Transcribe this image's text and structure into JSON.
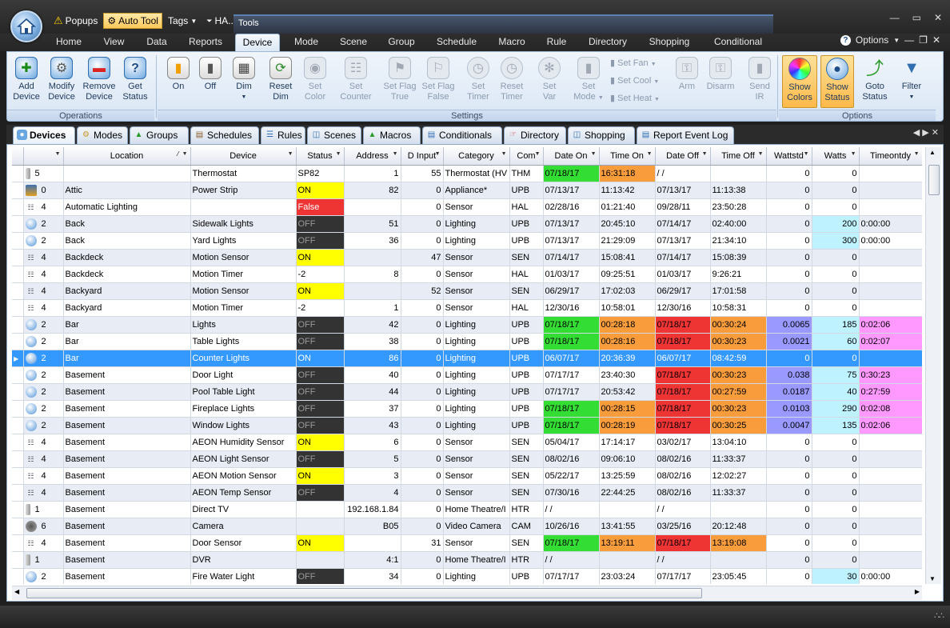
{
  "quick_access": {
    "popups": "Popups",
    "auto_tool": "Auto Tool",
    "tags": "Tags",
    "ha": "HA...",
    "tools": "Tools"
  },
  "ribbon_tabs": [
    "Home",
    "View",
    "Data",
    "Reports",
    "Device",
    "Mode",
    "Scene",
    "Group",
    "Schedule",
    "Macro",
    "Rule",
    "Directory",
    "Shopping",
    "Conditional"
  ],
  "options_label": "Options",
  "ribbon_groups": {
    "operations": "Operations",
    "settings": "Settings",
    "options": "Options"
  },
  "ribbon_buttons": {
    "add_device": [
      "Add",
      "Device"
    ],
    "modify_device": [
      "Modify",
      "Device"
    ],
    "remove_device": [
      "Remove",
      "Device"
    ],
    "get_status": [
      "Get",
      "Status"
    ],
    "on": "On",
    "off": "Off",
    "dim": "Dim",
    "reset_dim": [
      "Reset",
      "Dim"
    ],
    "set_color": [
      "Set",
      "Color"
    ],
    "set_counter": [
      "Set",
      "Counter"
    ],
    "set_flag_true": [
      "Set Flag",
      "True"
    ],
    "set_flag_false": [
      "Set Flag",
      "False"
    ],
    "set_timer": [
      "Set",
      "Timer"
    ],
    "reset_timer": [
      "Reset",
      "Timer"
    ],
    "set_var": [
      "Set",
      "Var"
    ],
    "set_mode": [
      "Set",
      "Mode"
    ],
    "set_fan": "Set Fan",
    "set_cool": "Set Cool",
    "set_heat": "Set Heat",
    "arm": "Arm",
    "disarm": "Disarm",
    "send_ir": [
      "Send",
      "IR"
    ],
    "show_colors": [
      "Show",
      "Colors"
    ],
    "show_status": [
      "Show",
      "Status"
    ],
    "goto_status": [
      "Goto",
      "Status"
    ],
    "filter": "Filter"
  },
  "doc_tabs": [
    "Devices",
    "Modes",
    "Groups",
    "Schedules",
    "Rules",
    "Scenes",
    "Macros",
    "Conditionals",
    "Directory",
    "Shopping",
    "Report Event Log"
  ],
  "columns": [
    "",
    "Location",
    "Device",
    "Status",
    "Address",
    "D Input",
    "Category",
    "Com",
    "Date On",
    "Time On",
    "Date Off",
    "Time Off",
    "Wattstd",
    "Watts",
    "Timeontdy"
  ],
  "colors": {
    "on_yellow": "#ffff00",
    "false_red": "#ef3434",
    "off_dark": "#333333",
    "green": "#33dd33",
    "orange": "#f99c3c",
    "red": "#ef3434",
    "purple": "#9999ff",
    "cyan": "#bff2ff",
    "pink": "#ff99ff",
    "selected": "#3399ff"
  },
  "rows": [
    {
      "icon": "thermostat-icon",
      "type": "5",
      "location": "",
      "device": "Thermostat",
      "status": "SP82",
      "address": "1",
      "dinput": "55",
      "category": "Thermostat (HV",
      "com": "THM",
      "date_on": "07/18/17",
      "time_on": "16:31:18",
      "date_off": " / /",
      "time_off": "",
      "wattstd": "0",
      "watts": "0",
      "timeontdy": "",
      "c_date_on": "green",
      "c_time_on": "orange"
    },
    {
      "icon": "power-strip-icon",
      "type": "0",
      "location": "Attic",
      "device": "Power Strip",
      "status": "ON",
      "address": "82",
      "dinput": "0",
      "category": "Appliance*",
      "com": "UPB",
      "date_on": "07/13/17",
      "time_on": "11:13:42",
      "date_off": "07/13/17",
      "time_off": "11:13:38",
      "wattstd": "0",
      "watts": "0",
      "timeontdy": "",
      "c_status": "on_yellow"
    },
    {
      "icon": "sensor-icon",
      "type": "4",
      "location": "Automatic Lighting",
      "device": "",
      "status": "False",
      "address": "",
      "dinput": "0",
      "category": "Sensor",
      "com": "HAL",
      "date_on": "02/28/16",
      "time_on": "01:21:40",
      "date_off": "09/28/11",
      "time_off": "23:50:28",
      "wattstd": "0",
      "watts": "0",
      "timeontdy": "",
      "c_status": "false_red"
    },
    {
      "icon": "bulb-icon",
      "type": "2",
      "location": "Back",
      "device": "Sidewalk Lights",
      "status": "OFF",
      "address": "51",
      "dinput": "0",
      "category": "Lighting",
      "com": "UPB",
      "date_on": "07/13/17",
      "time_on": "20:45:10",
      "date_off": "07/14/17",
      "time_off": "02:40:00",
      "wattstd": "0",
      "watts": "200",
      "timeontdy": "0:00:00",
      "c_status": "off_dark",
      "c_watts": "cyan"
    },
    {
      "icon": "bulb-icon",
      "type": "2",
      "location": "Back",
      "device": "Yard Lights",
      "status": "OFF",
      "address": "36",
      "dinput": "0",
      "category": "Lighting",
      "com": "UPB",
      "date_on": "07/13/17",
      "time_on": "21:29:09",
      "date_off": "07/13/17",
      "time_off": "21:34:10",
      "wattstd": "0",
      "watts": "300",
      "timeontdy": "0:00:00",
      "c_status": "off_dark",
      "c_watts": "cyan"
    },
    {
      "icon": "sensor-icon",
      "type": "4",
      "location": "Backdeck",
      "device": "Motion Sensor",
      "status": "ON",
      "address": "",
      "dinput": "47",
      "category": "Sensor",
      "com": "SEN",
      "date_on": "07/14/17",
      "time_on": "15:08:41",
      "date_off": "07/14/17",
      "time_off": "15:08:39",
      "wattstd": "0",
      "watts": "0",
      "timeontdy": "",
      "c_status": "on_yellow"
    },
    {
      "icon": "sensor-icon",
      "type": "4",
      "location": "Backdeck",
      "device": "Motion Timer",
      "status": "-2",
      "address": "8",
      "dinput": "0",
      "category": "Sensor",
      "com": "HAL",
      "date_on": "01/03/17",
      "time_on": "09:25:51",
      "date_off": "01/03/17",
      "time_off": "9:26:21",
      "wattstd": "0",
      "watts": "0",
      "timeontdy": ""
    },
    {
      "icon": "sensor-icon",
      "type": "4",
      "location": "Backyard",
      "device": "Motion Sensor",
      "status": "ON",
      "address": "",
      "dinput": "52",
      "category": "Sensor",
      "com": "SEN",
      "date_on": "06/29/17",
      "time_on": "17:02:03",
      "date_off": "06/29/17",
      "time_off": "17:01:58",
      "wattstd": "0",
      "watts": "0",
      "timeontdy": "",
      "c_status": "on_yellow"
    },
    {
      "icon": "sensor-icon",
      "type": "4",
      "location": "Backyard",
      "device": "Motion Timer",
      "status": "-2",
      "address": "1",
      "dinput": "0",
      "category": "Sensor",
      "com": "HAL",
      "date_on": "12/30/16",
      "time_on": "10:58:01",
      "date_off": "12/30/16",
      "time_off": "10:58:31",
      "wattstd": "0",
      "watts": "0",
      "timeontdy": ""
    },
    {
      "icon": "bulb-icon",
      "type": "2",
      "location": "Bar",
      "device": "Lights",
      "status": "OFF",
      "address": "42",
      "dinput": "0",
      "category": "Lighting",
      "com": "UPB",
      "date_on": "07/18/17",
      "time_on": "00:28:18",
      "date_off": "07/18/17",
      "time_off": "00:30:24",
      "wattstd": "0.0065",
      "watts": "185",
      "timeontdy": "0:02:06",
      "c_status": "off_dark",
      "c_date_on": "green",
      "c_time_on": "orange",
      "c_date_off": "red",
      "c_time_off": "orange",
      "c_wattstd": "purple",
      "c_watts": "cyan",
      "c_timeontdy": "pink"
    },
    {
      "icon": "bulb-icon",
      "type": "2",
      "location": "Bar",
      "device": "Table Lights",
      "status": "OFF",
      "address": "38",
      "dinput": "0",
      "category": "Lighting",
      "com": "UPB",
      "date_on": "07/18/17",
      "time_on": "00:28:16",
      "date_off": "07/18/17",
      "time_off": "00:30:23",
      "wattstd": "0.0021",
      "watts": "60",
      "timeontdy": "0:02:07",
      "c_status": "off_dark",
      "c_date_on": "green",
      "c_time_on": "orange",
      "c_date_off": "red",
      "c_time_off": "orange",
      "c_wattstd": "purple",
      "c_watts": "cyan",
      "c_timeontdy": "pink"
    },
    {
      "icon": "bulb-icon",
      "type": "2",
      "location": "Bar",
      "device": "Counter Lights",
      "status": "ON",
      "address": "86",
      "dinput": "0",
      "category": "Lighting",
      "com": "UPB",
      "date_on": "06/07/17",
      "time_on": "20:36:39",
      "date_off": "06/07/17",
      "time_off": "08:42:59",
      "wattstd": "0",
      "watts": "0",
      "timeontdy": "",
      "selected": true
    },
    {
      "icon": "bulb-icon",
      "type": "2",
      "location": "Basement",
      "device": "Door Light",
      "status": "OFF",
      "address": "40",
      "dinput": "0",
      "category": "Lighting",
      "com": "UPB",
      "date_on": "07/17/17",
      "time_on": "23:40:30",
      "date_off": "07/18/17",
      "time_off": "00:30:23",
      "wattstd": "0.038",
      "watts": "75",
      "timeontdy": "0:30:23",
      "c_status": "off_dark",
      "c_date_off": "red",
      "c_time_off": "orange",
      "c_wattstd": "purple",
      "c_watts": "cyan",
      "c_timeontdy": "pink"
    },
    {
      "icon": "bulb-icon",
      "type": "2",
      "location": "Basement",
      "device": "Pool Table Light",
      "status": "OFF",
      "address": "44",
      "dinput": "0",
      "category": "Lighting",
      "com": "UPB",
      "date_on": "07/17/17",
      "time_on": "20:53:42",
      "date_off": "07/18/17",
      "time_off": "00:27:59",
      "wattstd": "0.0187",
      "watts": "40",
      "timeontdy": "0:27:59",
      "c_status": "off_dark",
      "c_date_off": "red",
      "c_time_off": "orange",
      "c_wattstd": "purple",
      "c_watts": "cyan",
      "c_timeontdy": "pink"
    },
    {
      "icon": "bulb-icon",
      "type": "2",
      "location": "Basement",
      "device": "Fireplace Lights",
      "status": "OFF",
      "address": "37",
      "dinput": "0",
      "category": "Lighting",
      "com": "UPB",
      "date_on": "07/18/17",
      "time_on": "00:28:15",
      "date_off": "07/18/17",
      "time_off": "00:30:23",
      "wattstd": "0.0103",
      "watts": "290",
      "timeontdy": "0:02:08",
      "c_status": "off_dark",
      "c_date_on": "green",
      "c_time_on": "orange",
      "c_date_off": "red",
      "c_time_off": "orange",
      "c_wattstd": "purple",
      "c_watts": "cyan",
      "c_timeontdy": "pink"
    },
    {
      "icon": "bulb-icon",
      "type": "2",
      "location": "Basement",
      "device": "Window Lights",
      "status": "OFF",
      "address": "43",
      "dinput": "0",
      "category": "Lighting",
      "com": "UPB",
      "date_on": "07/18/17",
      "time_on": "00:28:19",
      "date_off": "07/18/17",
      "time_off": "00:30:25",
      "wattstd": "0.0047",
      "watts": "135",
      "timeontdy": "0:02:06",
      "c_status": "off_dark",
      "c_date_on": "green",
      "c_time_on": "orange",
      "c_date_off": "red",
      "c_time_off": "orange",
      "c_wattstd": "purple",
      "c_watts": "cyan",
      "c_timeontdy": "pink"
    },
    {
      "icon": "sensor-icon",
      "type": "4",
      "location": "Basement",
      "device": "AEON Humidity Sensor",
      "status": "ON",
      "address": "6",
      "dinput": "0",
      "category": "Sensor",
      "com": "SEN",
      "date_on": "05/04/17",
      "time_on": "17:14:17",
      "date_off": "03/02/17",
      "time_off": "13:04:10",
      "wattstd": "0",
      "watts": "0",
      "timeontdy": "",
      "c_status": "on_yellow"
    },
    {
      "icon": "sensor-icon",
      "type": "4",
      "location": "Basement",
      "device": "AEON Light Sensor",
      "status": "OFF",
      "address": "5",
      "dinput": "0",
      "category": "Sensor",
      "com": "SEN",
      "date_on": "08/02/16",
      "time_on": "09:06:10",
      "date_off": "08/02/16",
      "time_off": "11:33:37",
      "wattstd": "0",
      "watts": "0",
      "timeontdy": "",
      "c_status": "off_dark"
    },
    {
      "icon": "sensor-icon",
      "type": "4",
      "location": "Basement",
      "device": "AEON Motion Sensor",
      "status": "ON",
      "address": "3",
      "dinput": "0",
      "category": "Sensor",
      "com": "SEN",
      "date_on": "05/22/17",
      "time_on": "13:25:59",
      "date_off": "08/02/16",
      "time_off": "12:02:27",
      "wattstd": "0",
      "watts": "0",
      "timeontdy": "",
      "c_status": "on_yellow"
    },
    {
      "icon": "sensor-icon",
      "type": "4",
      "location": "Basement",
      "device": "AEON Temp Sensor",
      "status": "OFF",
      "address": "4",
      "dinput": "0",
      "category": "Sensor",
      "com": "SEN",
      "date_on": "07/30/16",
      "time_on": "22:44:25",
      "date_off": "08/02/16",
      "time_off": "11:33:37",
      "wattstd": "0",
      "watts": "0",
      "timeontdy": "",
      "c_status": "off_dark"
    },
    {
      "icon": "remote-icon",
      "type": "1",
      "location": "Basement",
      "device": "Direct TV",
      "status": "",
      "address": "192.168.1.84",
      "dinput": "0",
      "category": "Home Theatre/I",
      "com": "HTR",
      "date_on": " / /",
      "time_on": "",
      "date_off": " / /",
      "time_off": "",
      "wattstd": "0",
      "watts": "0",
      "timeontdy": ""
    },
    {
      "icon": "camera-icon",
      "type": "6",
      "location": "Basement",
      "device": "Camera",
      "status": "",
      "address": "B05",
      "dinput": "0",
      "category": "Video Camera",
      "com": "CAM",
      "date_on": "10/26/16",
      "time_on": "13:41:55",
      "date_off": "03/25/16",
      "time_off": "20:12:48",
      "wattstd": "0",
      "watts": "0",
      "timeontdy": ""
    },
    {
      "icon": "sensor-icon",
      "type": "4",
      "location": "Basement",
      "device": "Door Sensor",
      "status": "ON",
      "address": "",
      "dinput": "31",
      "category": "Sensor",
      "com": "SEN",
      "date_on": "07/18/17",
      "time_on": "13:19:11",
      "date_off": "07/18/17",
      "time_off": "13:19:08",
      "wattstd": "0",
      "watts": "0",
      "timeontdy": "",
      "c_status": "on_yellow",
      "c_date_on": "green",
      "c_time_on": "orange",
      "c_date_off": "red",
      "c_time_off": "orange"
    },
    {
      "icon": "remote-icon",
      "type": "1",
      "location": "Basement",
      "device": "DVR",
      "status": "",
      "address": "4:1",
      "dinput": "0",
      "category": "Home Theatre/I",
      "com": "HTR",
      "date_on": " / /",
      "time_on": "",
      "date_off": " / /",
      "time_off": "",
      "wattstd": "0",
      "watts": "0",
      "timeontdy": ""
    },
    {
      "icon": "bulb-icon",
      "type": "2",
      "location": "Basement",
      "device": "Fire Water Light",
      "status": "OFF",
      "address": "34",
      "dinput": "0",
      "category": "Lighting",
      "com": "UPB",
      "date_on": "07/17/17",
      "time_on": "23:03:24",
      "date_off": "07/17/17",
      "time_off": "23:05:45",
      "wattstd": "0",
      "watts": "30",
      "timeontdy": "0:00:00",
      "c_status": "off_dark",
      "c_watts": "cyan"
    }
  ]
}
